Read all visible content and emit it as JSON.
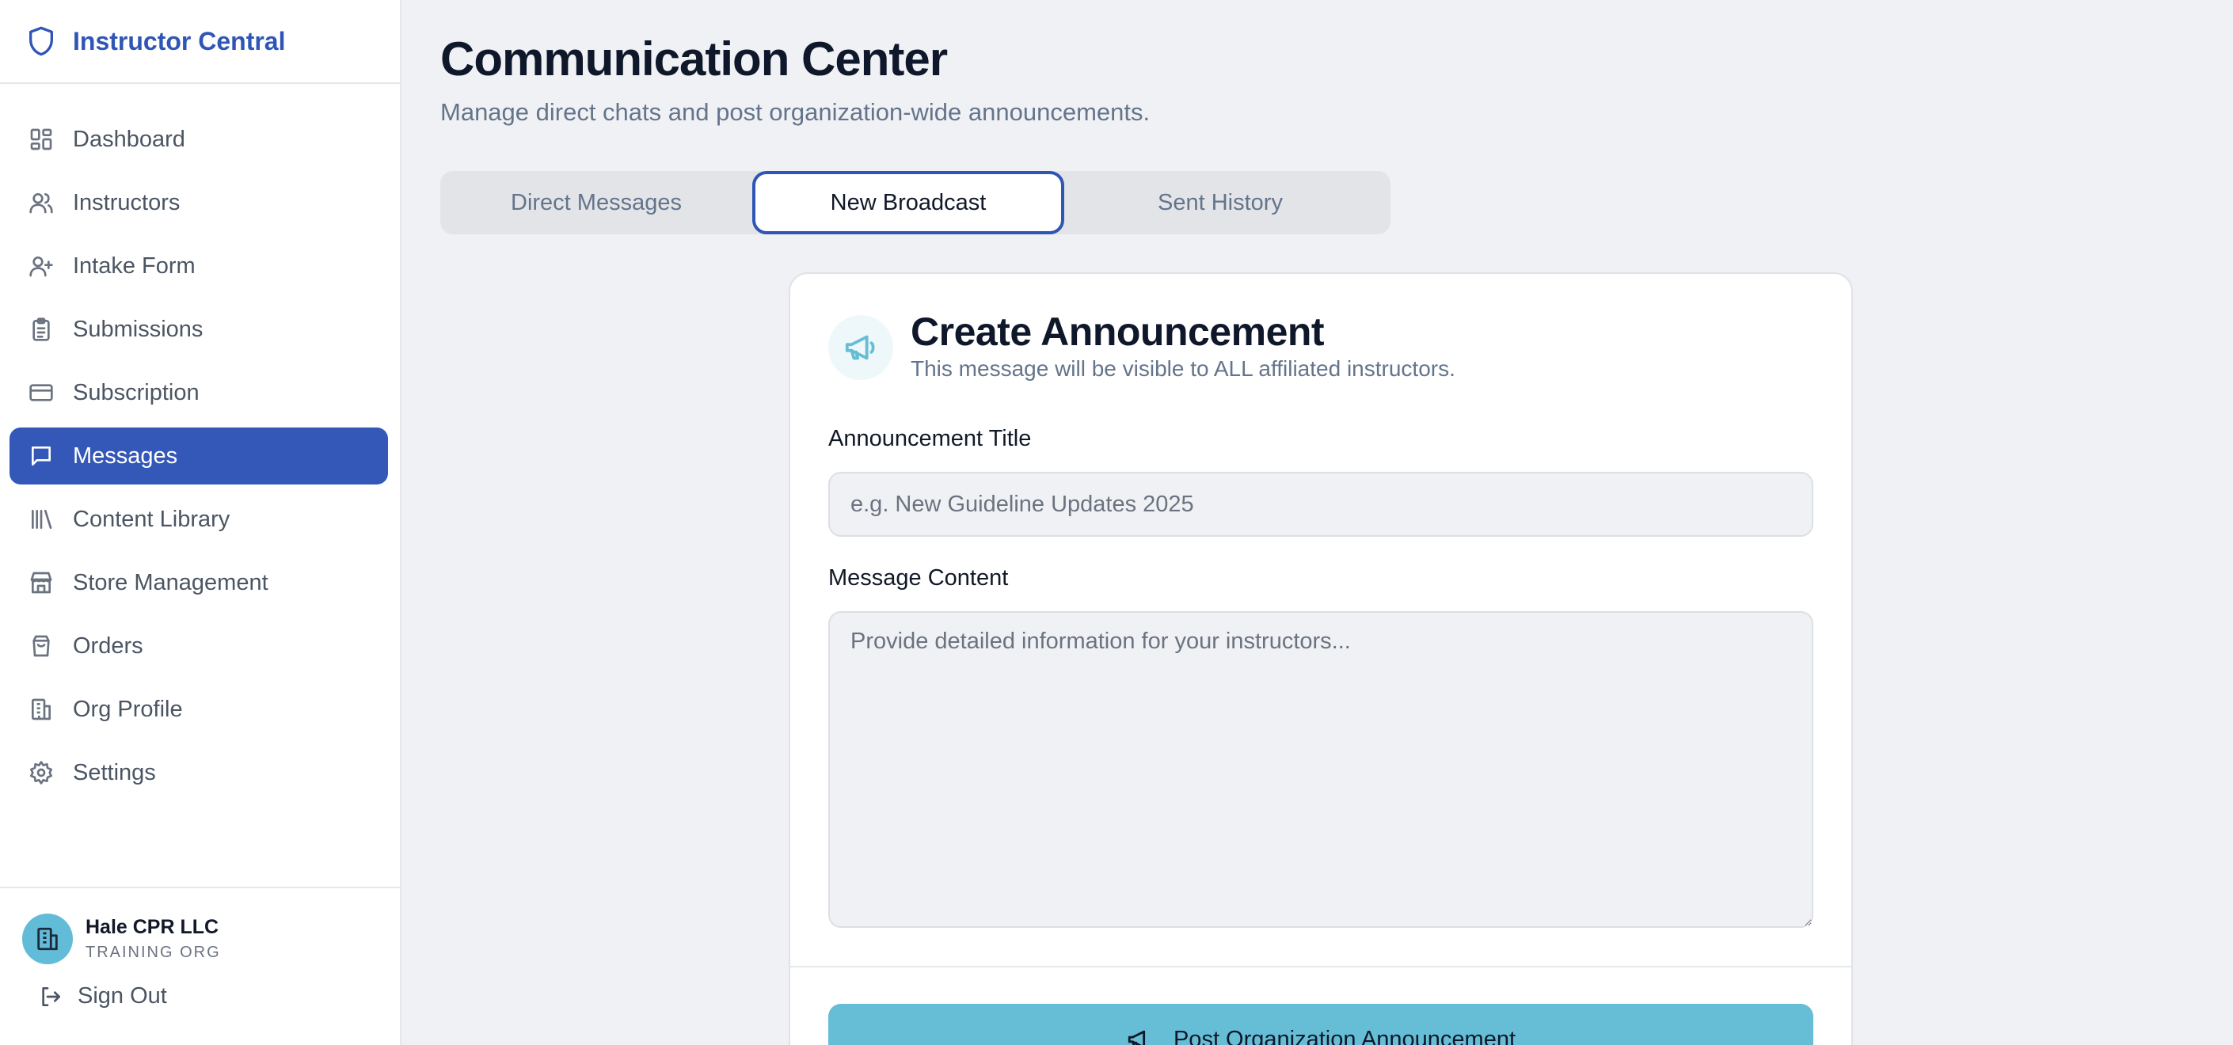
{
  "brand": {
    "title": "Instructor Central"
  },
  "sidebar": {
    "items": [
      {
        "label": "Dashboard",
        "icon": "dashboard-icon"
      },
      {
        "label": "Instructors",
        "icon": "users-icon"
      },
      {
        "label": "Intake Form",
        "icon": "user-plus-icon"
      },
      {
        "label": "Submissions",
        "icon": "clipboard-icon"
      },
      {
        "label": "Subscription",
        "icon": "credit-card-icon"
      },
      {
        "label": "Messages",
        "icon": "message-square-icon",
        "active": true
      },
      {
        "label": "Content Library",
        "icon": "library-icon"
      },
      {
        "label": "Store Management",
        "icon": "store-icon"
      },
      {
        "label": "Orders",
        "icon": "shopping-bag-icon"
      },
      {
        "label": "Org Profile",
        "icon": "building-icon"
      },
      {
        "label": "Settings",
        "icon": "gear-icon"
      }
    ],
    "org": {
      "name": "Hale CPR LLC",
      "type": "TRAINING ORG"
    },
    "sign_out": "Sign Out"
  },
  "main": {
    "title": "Communication Center",
    "subtitle": "Manage direct chats and post organization-wide announcements.",
    "tabs": [
      {
        "label": "Direct Messages"
      },
      {
        "label": "New Broadcast",
        "active": true
      },
      {
        "label": "Sent History"
      }
    ]
  },
  "card": {
    "title": "Create Announcement",
    "subtitle": "This message will be visible to ALL affiliated instructors.",
    "title_field": {
      "label": "Announcement Title",
      "placeholder": "e.g. New Guideline Updates 2025",
      "value": ""
    },
    "content_field": {
      "label": "Message Content",
      "placeholder": "Provide detailed information for your instructors...",
      "value": ""
    },
    "post_button": "Post Organization Announcement"
  },
  "colors": {
    "accent": "#3358b8",
    "brand_text": "#2f55b5",
    "broadcast_teal": "#66bed6",
    "background": "#f0f1f4"
  }
}
